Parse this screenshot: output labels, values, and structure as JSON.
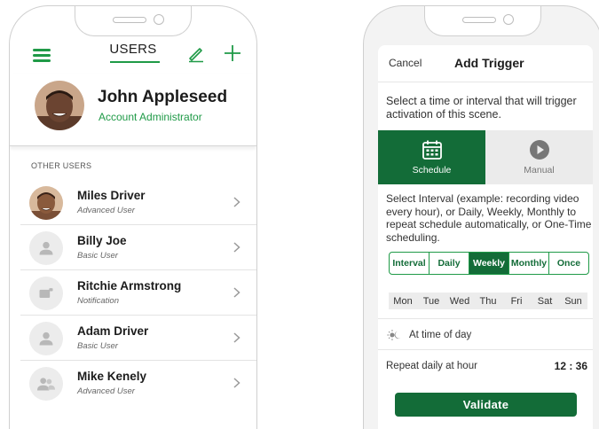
{
  "left_phone": {
    "header": {
      "title": "USERS",
      "menu_icon": "hamburger-icon",
      "edit_icon": "pencil-icon",
      "add_icon": "plus-icon"
    },
    "profile": {
      "name": "John Appleseed",
      "role": "Account Administrator"
    },
    "section_label": "OTHER USERS",
    "users": [
      {
        "name": "Miles Driver",
        "role": "Advanced User",
        "avatar": "photo"
      },
      {
        "name": "Billy Joe",
        "role": "Basic User",
        "avatar": "person-icon"
      },
      {
        "name": "Ritchie Armstrong",
        "role": "Notification",
        "avatar": "camera-icon"
      },
      {
        "name": "Adam Driver",
        "role": "Basic User",
        "avatar": "person-icon"
      },
      {
        "name": "Mike Kenely",
        "role": "Advanced User",
        "avatar": "group-icon"
      }
    ]
  },
  "right_phone": {
    "header": {
      "cancel": "Cancel",
      "title": "Add Trigger"
    },
    "description": "Select a time or interval that will trigger activation of this scene.",
    "modes": [
      {
        "label": "Schedule",
        "icon": "calendar-icon",
        "active": true
      },
      {
        "label": "Manual",
        "icon": "play-icon",
        "active": false
      }
    ],
    "interval_description": "Select Interval (example: recording video every hour), or Daily, Weekly, Monthly to repeat schedule automatically, or One-Time scheduling.",
    "frequencies": [
      {
        "label": "Interval",
        "active": false
      },
      {
        "label": "Daily",
        "active": false
      },
      {
        "label": "Weekly",
        "active": true
      },
      {
        "label": "Monthly",
        "active": false
      },
      {
        "label": "Once",
        "active": false
      }
    ],
    "days": [
      "Mon",
      "Tue",
      "Wed",
      "Thu",
      "Fri",
      "Sat",
      "Sun"
    ],
    "time_of_day": {
      "label": "At time of day",
      "icon": "day-night-icon"
    },
    "repeat": {
      "label": "Repeat daily at hour",
      "time": "12 : 36"
    },
    "validate_label": "Validate"
  },
  "colors": {
    "brand_green": "#1f9a47",
    "dark_green": "#136c38"
  }
}
